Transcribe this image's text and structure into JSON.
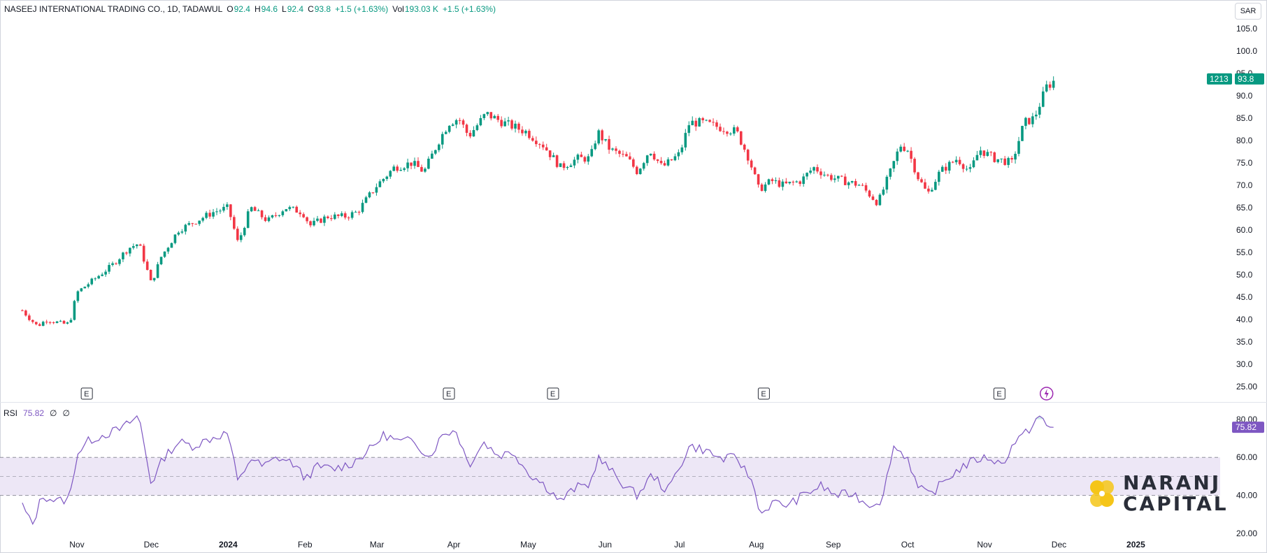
{
  "header": {
    "symbol": "NASEEJ INTERNATIONAL TRADING CO., 1D, TADAWUL",
    "o_label": "O",
    "o_value": "92.4",
    "h_label": "H",
    "h_value": "94.6",
    "l_label": "L",
    "l_value": "92.4",
    "c_label": "C",
    "c_value": "93.8",
    "change": "+1.5 (+1.63%)",
    "vol_label": "Vol",
    "vol_value": "193.03 K",
    "vol_change": "+1.5 (+1.63%)"
  },
  "currency_button": "SAR",
  "rsi_header": {
    "label": "RSI",
    "value": "75.82",
    "extra1": "∅",
    "extra2": "∅"
  },
  "logo": {
    "line1": "NARANJ",
    "line2": "CAPITAL"
  },
  "colors": {
    "up": "#089981",
    "down": "#f23645",
    "rsi": "#7e57c2",
    "band": "#ede7f6",
    "logo_yellow": "#f5c518"
  },
  "chart_data": [
    {
      "type": "candlestick",
      "title": "NASEEJ INTERNATIONAL TRADING CO., 1D, TADAWUL",
      "ylim": [
        22,
        108
      ],
      "y_ticks": [
        "105.0",
        "100.0",
        "95.0",
        "90.0",
        "85.0",
        "80.0",
        "75.0",
        "70.0",
        "65.0",
        "60.0",
        "55.0",
        "50.0",
        "45.0",
        "40.0",
        "35.0",
        "30.0",
        "25.00"
      ],
      "x_labels": [
        {
          "date": "2023-11-01",
          "text": "Nov"
        },
        {
          "date": "2023-12-01",
          "text": "Dec"
        },
        {
          "date": "2024-01-01",
          "text": "2024"
        },
        {
          "date": "2024-02-01",
          "text": "Feb"
        },
        {
          "date": "2024-03-01",
          "text": "Mar"
        },
        {
          "date": "2024-04-01",
          "text": "Apr"
        },
        {
          "date": "2024-05-01",
          "text": "May"
        },
        {
          "date": "2024-06-01",
          "text": "Jun"
        },
        {
          "date": "2024-07-01",
          "text": "Jul"
        },
        {
          "date": "2024-08-01",
          "text": "Aug"
        },
        {
          "date": "2024-09-01",
          "text": "Sep"
        },
        {
          "date": "2024-10-01",
          "text": "Oct"
        },
        {
          "date": "2024-11-01",
          "text": "Nov"
        },
        {
          "date": "2024-12-01",
          "text": "Dec"
        },
        {
          "date": "2025-01-01",
          "text": "2025"
        }
      ],
      "close_path": [
        [
          "2023-10-10",
          42
        ],
        [
          "2023-10-16",
          38.5
        ],
        [
          "2023-10-20",
          40
        ],
        [
          "2023-10-26",
          39
        ],
        [
          "2023-10-29",
          39
        ],
        [
          "2023-11-01",
          46
        ],
        [
          "2023-11-08",
          49
        ],
        [
          "2023-11-15",
          52
        ],
        [
          "2023-11-22",
          56
        ],
        [
          "2023-11-26",
          57
        ],
        [
          "2023-12-01",
          48
        ],
        [
          "2023-12-05",
          54
        ],
        [
          "2023-12-12",
          60
        ],
        [
          "2023-12-19",
          62
        ],
        [
          "2023-12-26",
          64
        ],
        [
          "2024-01-01",
          65
        ],
        [
          "2024-01-05",
          57
        ],
        [
          "2024-01-10",
          65
        ],
        [
          "2024-01-17",
          62
        ],
        [
          "2024-01-24",
          65
        ],
        [
          "2024-01-31",
          64
        ],
        [
          "2024-02-03",
          61
        ],
        [
          "2024-02-10",
          63
        ],
        [
          "2024-02-17",
          63
        ],
        [
          "2024-02-22",
          64
        ],
        [
          "2024-03-01",
          70
        ],
        [
          "2024-03-08",
          74
        ],
        [
          "2024-03-15",
          75
        ],
        [
          "2024-03-20",
          73
        ],
        [
          "2024-03-26",
          80
        ],
        [
          "2024-03-30",
          84
        ],
        [
          "2024-04-03",
          85
        ],
        [
          "2024-04-07",
          81
        ],
        [
          "2024-04-14",
          86
        ],
        [
          "2024-04-21",
          84
        ],
        [
          "2024-04-30",
          82
        ],
        [
          "2024-05-07",
          79
        ],
        [
          "2024-05-14",
          74
        ],
        [
          "2024-05-21",
          76
        ],
        [
          "2024-05-26",
          76
        ],
        [
          "2024-05-29",
          82
        ],
        [
          "2024-06-03",
          78
        ],
        [
          "2024-06-10",
          76
        ],
        [
          "2024-06-14",
          73
        ],
        [
          "2024-06-19",
          78
        ],
        [
          "2024-06-24",
          74
        ],
        [
          "2024-07-01",
          77
        ],
        [
          "2024-07-05",
          84
        ],
        [
          "2024-07-10",
          84
        ],
        [
          "2024-07-17",
          83
        ],
        [
          "2024-07-24",
          82
        ],
        [
          "2024-07-29",
          76
        ],
        [
          "2024-08-02",
          69
        ],
        [
          "2024-08-07",
          71
        ],
        [
          "2024-08-12",
          70
        ],
        [
          "2024-08-19",
          71
        ],
        [
          "2024-08-24",
          74
        ],
        [
          "2024-08-30",
          72
        ],
        [
          "2024-09-05",
          71
        ],
        [
          "2024-09-12",
          70
        ],
        [
          "2024-09-19",
          66
        ],
        [
          "2024-09-24",
          73
        ],
        [
          "2024-09-28",
          79
        ],
        [
          "2024-10-01",
          78
        ],
        [
          "2024-10-05",
          72
        ],
        [
          "2024-10-09",
          68
        ],
        [
          "2024-10-14",
          73
        ],
        [
          "2024-10-21",
          76
        ],
        [
          "2024-10-26",
          73
        ],
        [
          "2024-10-30",
          78
        ],
        [
          "2024-11-05",
          76
        ],
        [
          "2024-11-12",
          75
        ],
        [
          "2024-11-17",
          84
        ],
        [
          "2024-11-21",
          85
        ],
        [
          "2024-11-26",
          92
        ],
        [
          "2024-11-30",
          93.8
        ]
      ],
      "last_price_label": "93.8",
      "countdown_label": "1213",
      "earnings_markers": [
        {
          "date": "2023-11-05",
          "text": "E"
        },
        {
          "date": "2024-03-30",
          "text": "E"
        },
        {
          "date": "2024-05-11",
          "text": "E"
        },
        {
          "date": "2024-08-04",
          "text": "E"
        },
        {
          "date": "2024-11-07",
          "text": "E"
        }
      ],
      "dividend_marker_date": "2024-11-26"
    },
    {
      "type": "line",
      "series": [
        {
          "name": "RSI"
        }
      ],
      "ylim": [
        16,
        88
      ],
      "y_ticks": [
        "80.00",
        "60.00",
        "40.00",
        "20.00"
      ],
      "band": [
        40,
        60
      ],
      "midline": 50,
      "last_value_label": "75.82",
      "path": [
        [
          "2023-10-10",
          35
        ],
        [
          "2023-10-14",
          24
        ],
        [
          "2023-10-18",
          40
        ],
        [
          "2023-10-24",
          37
        ],
        [
          "2023-10-29",
          38
        ],
        [
          "2023-11-01",
          62
        ],
        [
          "2023-11-06",
          69
        ],
        [
          "2023-11-12",
          72
        ],
        [
          "2023-11-19",
          75
        ],
        [
          "2023-11-26",
          82
        ],
        [
          "2023-12-01",
          46
        ],
        [
          "2023-12-06",
          60
        ],
        [
          "2023-12-12",
          68
        ],
        [
          "2023-12-18",
          66
        ],
        [
          "2023-12-25",
          70
        ],
        [
          "2024-01-01",
          73
        ],
        [
          "2024-01-05",
          46
        ],
        [
          "2024-01-10",
          60
        ],
        [
          "2024-01-15",
          55
        ],
        [
          "2024-01-21",
          60
        ],
        [
          "2024-01-27",
          57
        ],
        [
          "2024-02-01",
          49
        ],
        [
          "2024-02-06",
          55
        ],
        [
          "2024-02-13",
          54
        ],
        [
          "2024-02-20",
          57
        ],
        [
          "2024-02-27",
          64
        ],
        [
          "2024-03-04",
          72
        ],
        [
          "2024-03-10",
          68
        ],
        [
          "2024-03-16",
          69
        ],
        [
          "2024-03-22",
          60
        ],
        [
          "2024-03-28",
          73
        ],
        [
          "2024-04-02",
          74
        ],
        [
          "2024-04-07",
          56
        ],
        [
          "2024-04-13",
          68
        ],
        [
          "2024-04-19",
          61
        ],
        [
          "2024-04-25",
          63
        ],
        [
          "2024-05-01",
          52
        ],
        [
          "2024-05-08",
          45
        ],
        [
          "2024-05-14",
          37
        ],
        [
          "2024-05-20",
          44
        ],
        [
          "2024-05-26",
          46
        ],
        [
          "2024-05-29",
          60
        ],
        [
          "2024-06-04",
          52
        ],
        [
          "2024-06-09",
          45
        ],
        [
          "2024-06-14",
          40
        ],
        [
          "2024-06-20",
          51
        ],
        [
          "2024-06-26",
          42
        ],
        [
          "2024-07-01",
          55
        ],
        [
          "2024-07-05",
          66
        ],
        [
          "2024-07-11",
          64
        ],
        [
          "2024-07-18",
          59
        ],
        [
          "2024-07-24",
          60
        ],
        [
          "2024-07-30",
          48
        ],
        [
          "2024-08-03",
          30
        ],
        [
          "2024-08-07",
          36
        ],
        [
          "2024-08-14",
          35
        ],
        [
          "2024-08-21",
          41
        ],
        [
          "2024-08-27",
          45
        ],
        [
          "2024-09-02",
          40
        ],
        [
          "2024-09-09",
          41
        ],
        [
          "2024-09-15",
          35
        ],
        [
          "2024-09-21",
          38
        ],
        [
          "2024-09-25",
          66
        ],
        [
          "2024-10-01",
          60
        ],
        [
          "2024-10-05",
          44
        ],
        [
          "2024-10-10",
          40
        ],
        [
          "2024-10-16",
          48
        ],
        [
          "2024-10-23",
          55
        ],
        [
          "2024-10-29",
          59
        ],
        [
          "2024-11-03",
          60
        ],
        [
          "2024-11-08",
          56
        ],
        [
          "2024-11-13",
          68
        ],
        [
          "2024-11-18",
          73
        ],
        [
          "2024-11-23",
          82
        ],
        [
          "2024-11-26",
          76
        ],
        [
          "2024-11-30",
          75.82
        ]
      ]
    }
  ]
}
